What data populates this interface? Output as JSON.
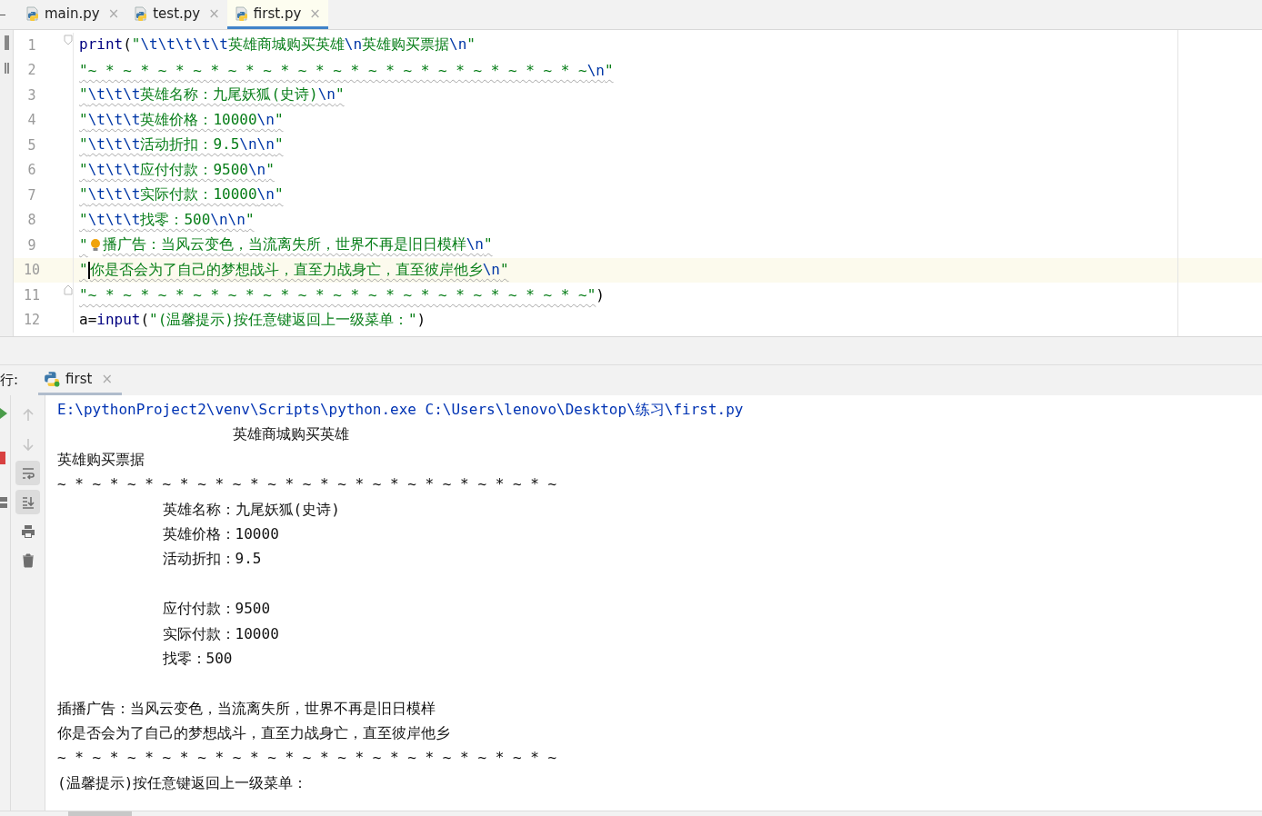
{
  "editor_tabs": [
    {
      "label": "main.py",
      "close": "×",
      "selected": false
    },
    {
      "label": "test.py",
      "close": "×",
      "selected": false
    },
    {
      "label": "first.py",
      "close": "×",
      "selected": true
    }
  ],
  "code_lines": [
    {
      "number": "1",
      "current": false,
      "warned": false,
      "kind": "fold-start",
      "hint": false,
      "segments": [
        {
          "kind": "builtin",
          "text": "print"
        },
        {
          "kind": "plain",
          "text": "("
        },
        {
          "kind": "string",
          "text": "\""
        },
        {
          "kind": "escape",
          "text": "\\t\\t\\t\\t\\t"
        },
        {
          "kind": "string",
          "text": "英雄商城购买英雄"
        },
        {
          "kind": "escape",
          "text": "\\n"
        },
        {
          "kind": "string",
          "text": "英雄购买票据"
        },
        {
          "kind": "escape",
          "text": "\\n"
        },
        {
          "kind": "string",
          "text": "\""
        }
      ]
    },
    {
      "number": "2",
      "current": false,
      "warned": true,
      "hint": false,
      "segments": [
        {
          "kind": "string",
          "text": "\"~ * ~ * ~ * ~ * ~ * ~ * ~ * ~ * ~ * ~ * ~ * ~ * ~ * ~ * ~"
        },
        {
          "kind": "escape",
          "text": "\\n"
        },
        {
          "kind": "string",
          "text": "\""
        }
      ]
    },
    {
      "number": "3",
      "current": false,
      "warned": true,
      "hint": false,
      "segments": [
        {
          "kind": "string",
          "text": "\""
        },
        {
          "kind": "escape",
          "text": "\\t\\t\\t"
        },
        {
          "kind": "string",
          "text": "英雄名称：九尾妖狐(史诗)"
        },
        {
          "kind": "escape",
          "text": "\\n"
        },
        {
          "kind": "string",
          "text": "\""
        }
      ]
    },
    {
      "number": "4",
      "current": false,
      "warned": true,
      "hint": false,
      "segments": [
        {
          "kind": "string",
          "text": "\""
        },
        {
          "kind": "escape",
          "text": "\\t\\t\\t"
        },
        {
          "kind": "string",
          "text": "英雄价格：10000"
        },
        {
          "kind": "escape",
          "text": "\\n"
        },
        {
          "kind": "string",
          "text": "\""
        }
      ]
    },
    {
      "number": "5",
      "current": false,
      "warned": true,
      "hint": false,
      "segments": [
        {
          "kind": "string",
          "text": "\""
        },
        {
          "kind": "escape",
          "text": "\\t\\t\\t"
        },
        {
          "kind": "string",
          "text": "活动折扣：9.5"
        },
        {
          "kind": "escape",
          "text": "\\n\\n"
        },
        {
          "kind": "string",
          "text": "\""
        }
      ]
    },
    {
      "number": "6",
      "current": false,
      "warned": true,
      "hint": false,
      "segments": [
        {
          "kind": "string",
          "text": "\""
        },
        {
          "kind": "escape",
          "text": "\\t\\t\\t"
        },
        {
          "kind": "string",
          "text": "应付付款：9500"
        },
        {
          "kind": "escape",
          "text": "\\n"
        },
        {
          "kind": "string",
          "text": "\""
        }
      ]
    },
    {
      "number": "7",
      "current": false,
      "warned": true,
      "hint": false,
      "segments": [
        {
          "kind": "string",
          "text": "\""
        },
        {
          "kind": "escape",
          "text": "\\t\\t\\t"
        },
        {
          "kind": "string",
          "text": "实际付款：10000"
        },
        {
          "kind": "escape",
          "text": "\\n"
        },
        {
          "kind": "string",
          "text": "\""
        }
      ]
    },
    {
      "number": "8",
      "current": false,
      "warned": true,
      "hint": false,
      "segments": [
        {
          "kind": "string",
          "text": "\""
        },
        {
          "kind": "escape",
          "text": "\\t\\t\\t"
        },
        {
          "kind": "string",
          "text": "找零：500"
        },
        {
          "kind": "escape",
          "text": "\\n\\n"
        },
        {
          "kind": "string",
          "text": "\""
        }
      ]
    },
    {
      "number": "9",
      "current": false,
      "warned": true,
      "hint": true,
      "segments": [
        {
          "kind": "string",
          "text": "\""
        },
        {
          "kind": "string",
          "text": "播广告：当风云变色，当流离失所，世界不再是旧日模样"
        },
        {
          "kind": "escape",
          "text": "\\n"
        },
        {
          "kind": "string",
          "text": "\""
        }
      ]
    },
    {
      "number": "10",
      "current": true,
      "warned": true,
      "hint": false,
      "segments": [
        {
          "kind": "string",
          "text": "\""
        },
        {
          "kind": "string",
          "text": "你是否会为了自己的梦想战斗，直至力战身亡，直至彼岸他乡"
        },
        {
          "kind": "escape",
          "text": "\\n"
        },
        {
          "kind": "string",
          "text": "\""
        }
      ]
    },
    {
      "number": "11",
      "current": false,
      "warned": true,
      "kind": "fold-end",
      "hint": false,
      "segments": [
        {
          "kind": "string",
          "text": "\"~ * ~ * ~ * ~ * ~ * ~ * ~ * ~ * ~ * ~ * ~ * ~ * ~ * ~ * ~\""
        },
        {
          "kind": "plain",
          "text": ")"
        }
      ]
    },
    {
      "number": "12",
      "current": false,
      "warned": false,
      "hint": false,
      "segments": [
        {
          "kind": "plain",
          "text": "a="
        },
        {
          "kind": "builtin",
          "text": "input"
        },
        {
          "kind": "plain",
          "text": "("
        },
        {
          "kind": "string",
          "text": "\"(温馨提示)按任意键返回上一级菜单：\""
        },
        {
          "kind": "plain",
          "text": ")"
        }
      ]
    }
  ],
  "run_panel": {
    "label": "行:",
    "tab": {
      "label": "first",
      "close": "×",
      "selected": true
    }
  },
  "console_tools": [
    {
      "kind": "up",
      "disabled": true,
      "on": false
    },
    {
      "kind": "down",
      "disabled": true,
      "on": false
    },
    {
      "kind": "wrap",
      "disabled": false,
      "on": true
    },
    {
      "kind": "scroll-end",
      "disabled": false,
      "on": true
    },
    {
      "kind": "print",
      "disabled": false,
      "on": false
    },
    {
      "kind": "trash",
      "disabled": false,
      "on": false
    }
  ],
  "console_lines": [
    {
      "kind": "command",
      "text": "E:\\pythonProject2\\venv\\Scripts\\python.exe C:\\Users\\lenovo\\Desktop\\练习\\first.py"
    },
    {
      "kind": "output",
      "text": "\t\t\t\t\t英雄商城购买英雄"
    },
    {
      "kind": "output",
      "text": "英雄购买票据"
    },
    {
      "kind": "output",
      "text": "~ * ~ * ~ * ~ * ~ * ~ * ~ * ~ * ~ * ~ * ~ * ~ * ~ * ~ * ~"
    },
    {
      "kind": "output",
      "text": "\t\t\t英雄名称：九尾妖狐(史诗)"
    },
    {
      "kind": "output",
      "text": "\t\t\t英雄价格：10000"
    },
    {
      "kind": "output",
      "text": "\t\t\t活动折扣：9.5"
    },
    {
      "kind": "blank"
    },
    {
      "kind": "output",
      "text": "\t\t\t应付付款：9500"
    },
    {
      "kind": "output",
      "text": "\t\t\t实际付款：10000"
    },
    {
      "kind": "output",
      "text": "\t\t\t找零：500"
    },
    {
      "kind": "blank"
    },
    {
      "kind": "output",
      "text": "插播广告：当风云变色，当流离失所，世界不再是旧日模样"
    },
    {
      "kind": "output",
      "text": "你是否会为了自己的梦想战斗，直至力战身亡，直至彼岸他乡"
    },
    {
      "kind": "output",
      "text": "~ * ~ * ~ * ~ * ~ * ~ * ~ * ~ * ~ * ~ * ~ * ~ * ~ * ~ * ~"
    },
    {
      "kind": "output",
      "text": "(温馨提示)按任意键返回上一级菜单："
    }
  ]
}
